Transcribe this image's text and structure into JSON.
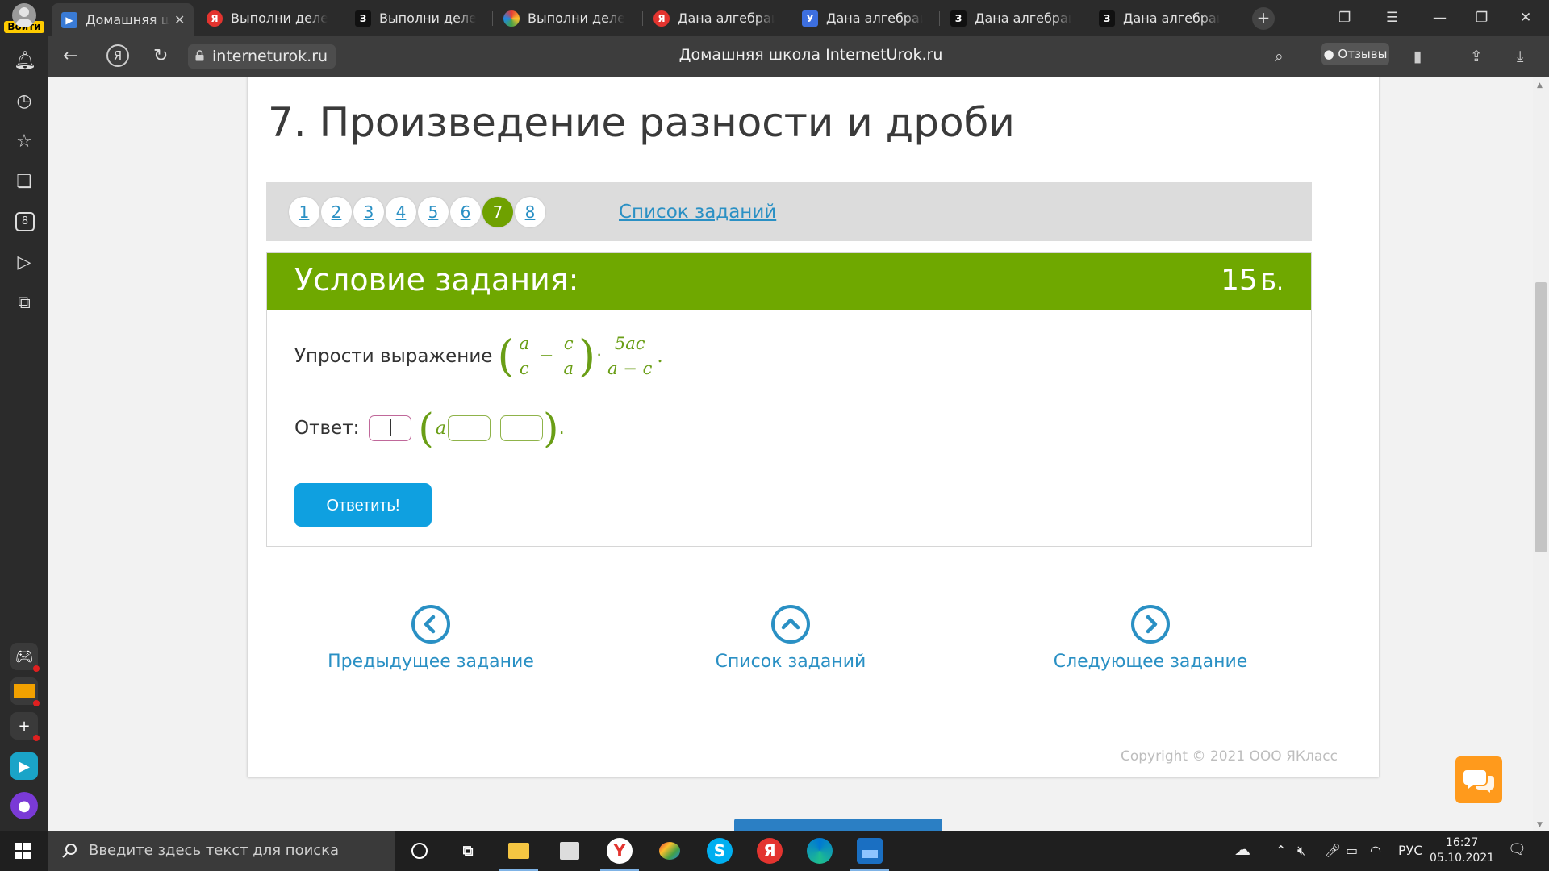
{
  "browser": {
    "login_label": "Войти",
    "tabs": [
      {
        "title": "Домашняя шк",
        "icon": "internet-urok-icon",
        "active": true
      },
      {
        "title": "Выполни делени",
        "icon": "yandex-icon"
      },
      {
        "title": "Выполни делени",
        "icon": "znanija-icon"
      },
      {
        "title": "Выполни делени",
        "icon": "pinwheel-icon"
      },
      {
        "title": "Дана алгебраиче",
        "icon": "yandex-icon"
      },
      {
        "title": "Дана алгебраиче",
        "icon": "uchi-icon"
      },
      {
        "title": "Дана алгебраиче",
        "icon": "znanija-icon"
      },
      {
        "title": "Дана алгебраиче",
        "icon": "znanija-icon"
      }
    ],
    "url": "interneturok.ru",
    "page_title": "Домашняя школа InternetUrok.ru",
    "reviews_label": "Отзывы"
  },
  "page": {
    "heading": "7. Произведение разности и дроби",
    "pager": {
      "numbers": [
        "1",
        "2",
        "3",
        "4",
        "5",
        "6",
        "7",
        "8"
      ],
      "current": "7",
      "list_link": "Список заданий"
    },
    "task": {
      "header": "Условие задания:",
      "points": "15",
      "points_unit": "Б.",
      "question_text": "Упрости выражение",
      "math": {
        "f1_num": "a",
        "f1_den": "c",
        "minus": "−",
        "f2_num": "c",
        "f2_den": "a",
        "dot": "·",
        "f3_num": "5ac",
        "f3_den": "a − c",
        "period": "."
      },
      "answer_label": "Ответ:",
      "answer_var": "a",
      "answer_period": ".",
      "submit_label": "Ответить!"
    },
    "nav": {
      "prev": "Предыдущее задание",
      "list": "Список заданий",
      "next": "Следующее задание"
    },
    "copyright": "Copyright © 2021 ООО ЯКласс"
  },
  "taskbar": {
    "search_placeholder": "Введите здесь текст для поиска",
    "lang": "РУС",
    "time": "16:27",
    "date": "05.10.2021"
  },
  "colors": {
    "accent_green": "#6fa800",
    "link_blue": "#2a90c4",
    "button_blue": "#0fa0e0",
    "chat_orange": "#ff9a1c"
  }
}
